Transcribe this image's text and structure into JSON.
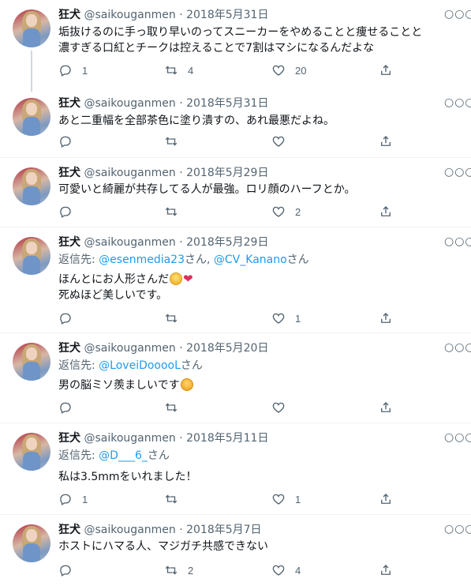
{
  "tweets": [
    {
      "name": "狂犬",
      "handle": "@saikouganmen",
      "dot": "·",
      "date": "2018年5月31日",
      "reply_prefix": "",
      "reply_users": [],
      "reply_suffix": "",
      "lines": [
        "垢抜けるのに手っ取り早いのってスニーカーをやめることと痩せることと",
        "濃すぎる口紅とチークは控えることで7割はマシになるんだよな"
      ],
      "emojis": [],
      "replies": "1",
      "retweets": "4",
      "likes": "20"
    },
    {
      "name": "狂犬",
      "handle": "@saikouganmen",
      "dot": "·",
      "date": "2018年5月31日",
      "reply_prefix": "",
      "reply_users": [],
      "reply_suffix": "",
      "lines": [
        "あと二重幅を全部茶色に塗り潰すの、あれ最悪だよね。"
      ],
      "emojis": [],
      "replies": "",
      "retweets": "",
      "likes": ""
    },
    {
      "name": "狂犬",
      "handle": "@saikouganmen",
      "dot": "·",
      "date": "2018年5月29日",
      "reply_prefix": "",
      "reply_users": [],
      "reply_suffix": "",
      "lines": [
        "可愛いと綺麗が共存してる人が最強。ロリ顔のハーフとか。"
      ],
      "emojis": [],
      "replies": "",
      "retweets": "",
      "likes": "2"
    },
    {
      "name": "狂犬",
      "handle": "@saikouganmen",
      "dot": "·",
      "date": "2018年5月29日",
      "reply_prefix": "返信先: ",
      "reply_users": [
        "@esenmedia23",
        "@CV_Kanano"
      ],
      "reply_sep": "さん, ",
      "reply_suffix": "さん",
      "lines": [
        "ほんとにお人形さんだ",
        "死ぬほど美しいです。"
      ],
      "emojis": [
        "face-scream-emoji",
        "heart-emoji"
      ],
      "replies": "",
      "retweets": "",
      "likes": "1"
    },
    {
      "name": "狂犬",
      "handle": "@saikouganmen",
      "dot": "·",
      "date": "2018年5月20日",
      "reply_prefix": "返信先: ",
      "reply_users": [
        "@LoveiDooooL"
      ],
      "reply_suffix": "さん",
      "lines": [
        "男の脳ミソ羨ましいです"
      ],
      "emojis": [
        "smile-emoji"
      ],
      "replies": "",
      "retweets": "",
      "likes": ""
    },
    {
      "name": "狂犬",
      "handle": "@saikouganmen",
      "dot": "·",
      "date": "2018年5月11日",
      "reply_prefix": "返信先: ",
      "reply_users": [
        "@D___6_"
      ],
      "reply_suffix": "さん",
      "lines": [
        "私は3.5mmをいれました！"
      ],
      "emojis": [],
      "replies": "1",
      "retweets": "",
      "likes": "1"
    },
    {
      "name": "狂犬",
      "handle": "@saikouganmen",
      "dot": "·",
      "date": "2018年5月7日",
      "reply_prefix": "",
      "reply_users": [],
      "reply_suffix": "",
      "lines": [
        "ホストにハマる人、マジガチ共感できない"
      ],
      "emojis": [],
      "replies": "",
      "retweets": "2",
      "likes": "4"
    }
  ],
  "icons": {
    "reply": "reply-icon",
    "retweet": "retweet-icon",
    "like": "heart-icon",
    "share": "share-icon",
    "more": "more-icon",
    "more_glyph": "○○○"
  },
  "colors": {
    "link": "#1d9bf0",
    "secondary": "#536471",
    "text": "#0f1419",
    "divider": "#eff3f4"
  }
}
